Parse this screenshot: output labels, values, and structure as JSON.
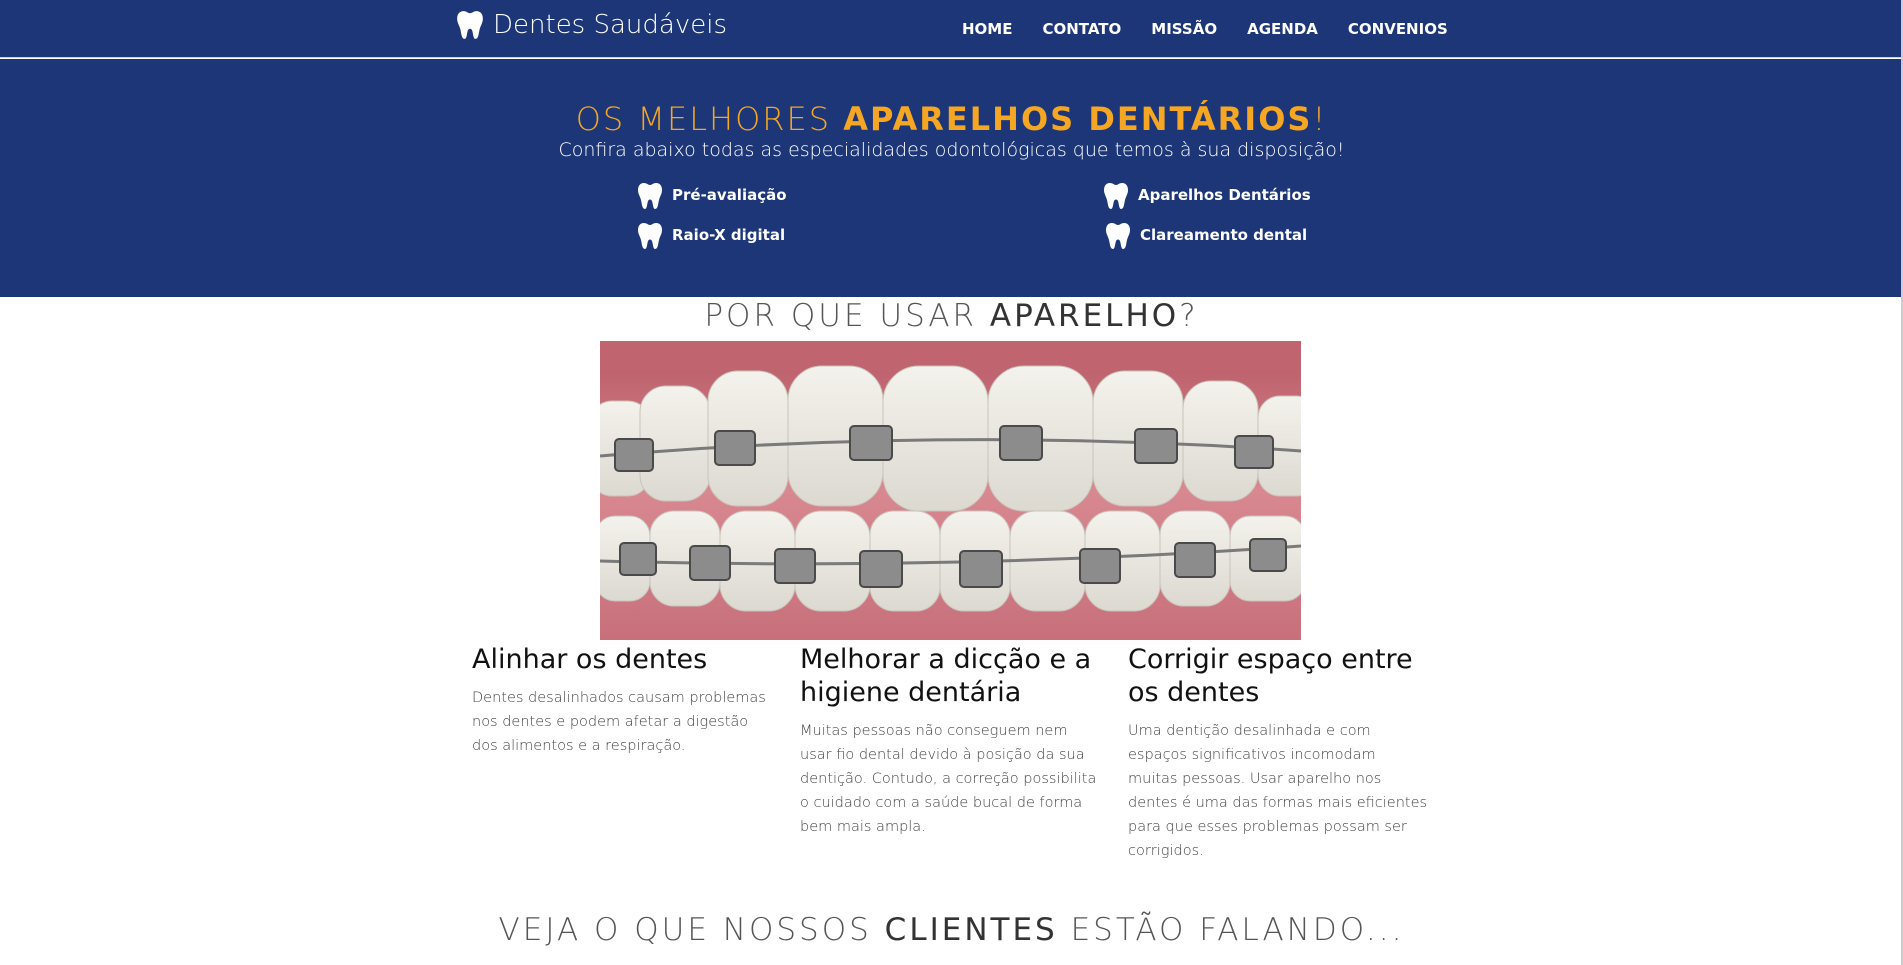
{
  "brand": {
    "name": "Dentes Saudáveis",
    "icon": "tooth-icon"
  },
  "nav": [
    "HOME",
    "CONTATO",
    "MISSÃO",
    "AGENDA",
    "CONVENIOS"
  ],
  "hero": {
    "title_prefix": "OS MELHORES ",
    "title_strong": "APARELHOS DENTÁRIOS",
    "title_suffix": "!",
    "subtitle": "Confira abaixo todas as especialidades odontológicas que temos à sua disposição!",
    "specialties": [
      "Pré-avaliação",
      "Aparelhos Dentários",
      "Raio-X digital",
      "Clareamento dental"
    ]
  },
  "why": {
    "title_prefix": "POR QUE USAR ",
    "title_strong": "APARELHO",
    "title_suffix": "?",
    "columns": [
      {
        "heading": "Alinhar os dentes",
        "text": "Dentes desalinhados causam problemas nos dentes e podem afetar a digestão dos alimentos e a respiração."
      },
      {
        "heading": "Melhorar a dicção e a higiene dentária",
        "text": "Muitas pessoas não conseguem nem usar fio dental devido à posição da sua dentição. Contudo, a correção possibilita o cuidado com a saúde bucal de forma bem mais ampla."
      },
      {
        "heading": "Corrigir espaço entre os dentes",
        "text": "Uma dentição desalinhada e com espaços significativos incomodam muitas pessoas. Usar aparelho nos dentes é uma das formas mais eficientes para que esses problemas possam ser corrigidos."
      }
    ]
  },
  "testimonials": {
    "title_prefix": "VEJA O QUE NOSSOS ",
    "title_strong": "CLIENTES",
    "title_suffix": " ESTÃO FALANDO..."
  },
  "colors": {
    "primary": "#1c3677",
    "accent": "#f5a623"
  }
}
